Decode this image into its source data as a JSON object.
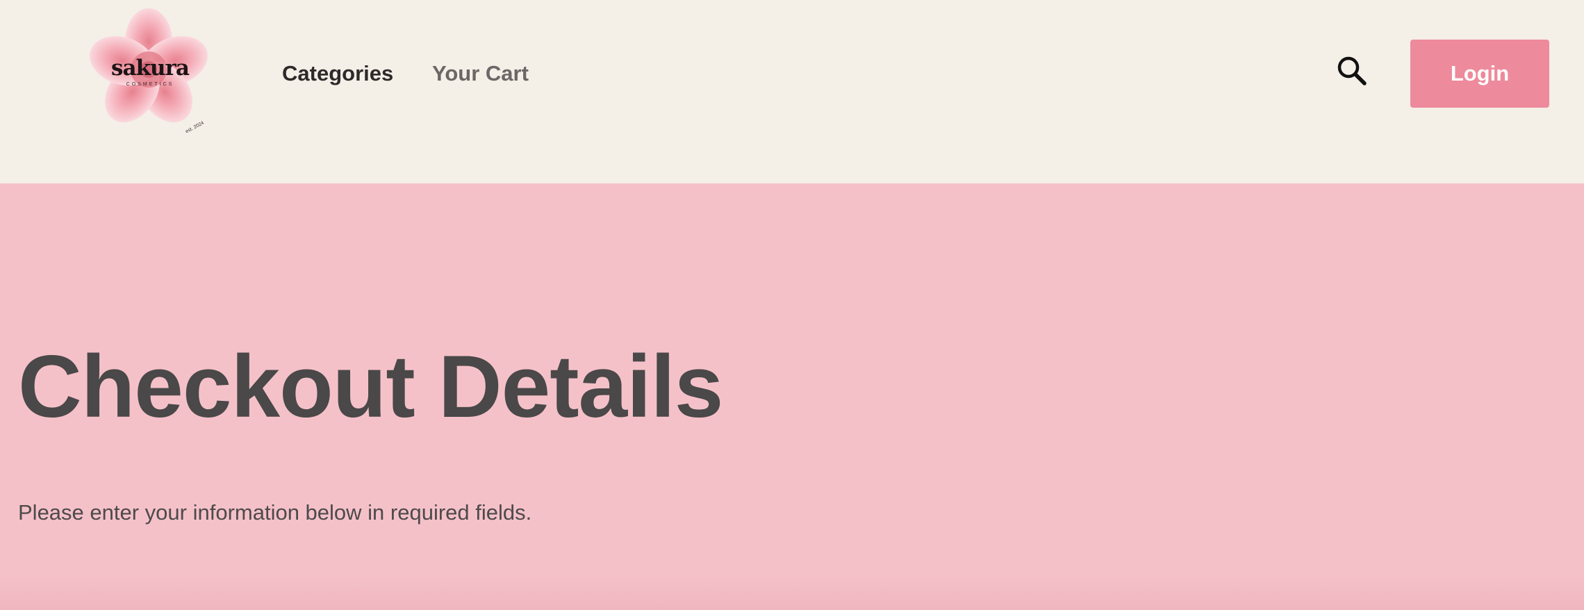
{
  "header": {
    "logo": {
      "name": "sakura",
      "subtitle": "COSMETICS",
      "established": "est. 2024"
    },
    "nav": [
      {
        "label": "Categories"
      },
      {
        "label": "Your Cart"
      }
    ],
    "search_icon": "search-icon",
    "login_label": "Login"
  },
  "main": {
    "title": "Checkout Details",
    "subtitle": "Please enter your information below in required fields."
  },
  "colors": {
    "header_bg": "#f4efe7",
    "page_bg": "#f5c1c9",
    "accent": "#ed8a9b",
    "title_text": "#4a4848"
  }
}
